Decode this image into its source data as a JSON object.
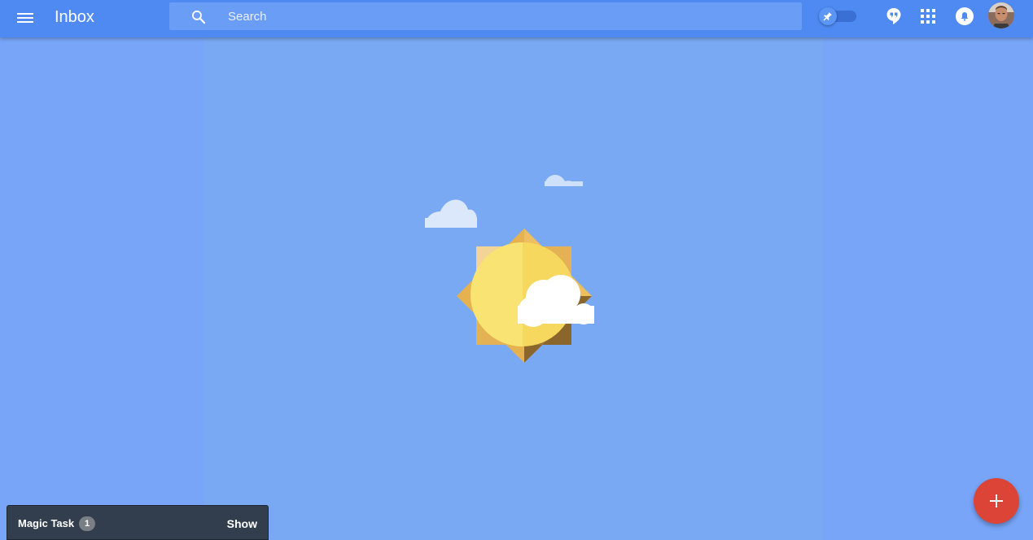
{
  "header": {
    "app_title": "Inbox",
    "search_placeholder": "Search"
  },
  "icons": {
    "menu": "menu-icon",
    "search": "search-icon",
    "pin": "pin-icon",
    "hangouts": "hangouts-icon",
    "apps": "apps-grid-icon",
    "notifications": "bell-icon",
    "compose": "plus-icon"
  },
  "colors": {
    "header": "#4e8af2",
    "background": "#7aa9f3",
    "fab": "#db4437",
    "snackbar": "#323e4d"
  },
  "snackbar": {
    "label": "Magic Task",
    "count": "1",
    "action": "Show"
  }
}
